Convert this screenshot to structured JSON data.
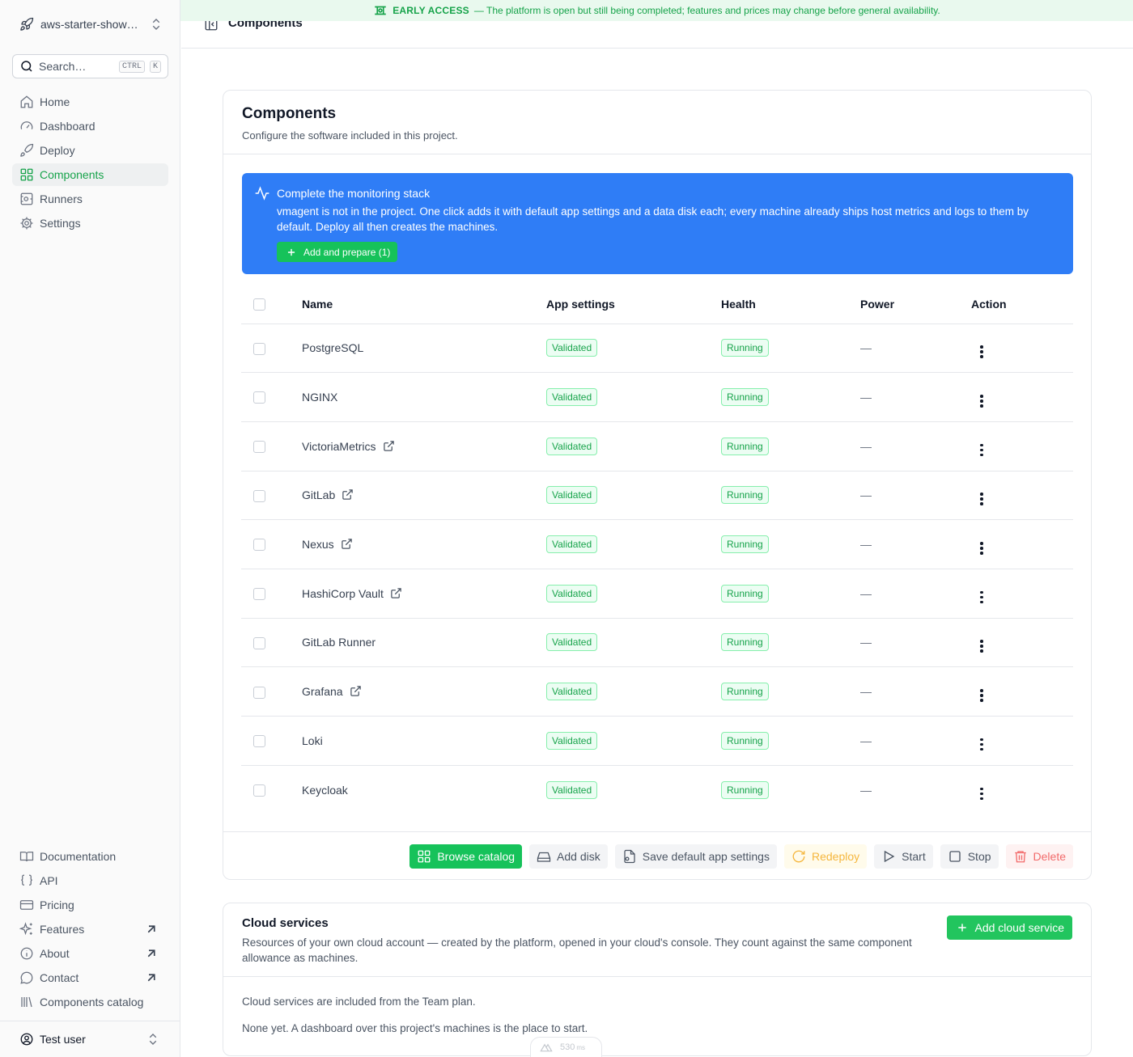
{
  "banner": {
    "tag": "EARLY ACCESS",
    "text": "— The platform is open but still being completed; features and prices may change before general availability."
  },
  "sidebar": {
    "project_name": "aws-starter-showc…",
    "search": {
      "placeholder": "Search…",
      "kbd_ctrl": "CTRL",
      "kbd_k": "K"
    },
    "nav": [
      {
        "label": "Home",
        "icon": "home-icon"
      },
      {
        "label": "Dashboard",
        "icon": "gauge-icon"
      },
      {
        "label": "Deploy",
        "icon": "rocket-icon"
      },
      {
        "label": "Components",
        "icon": "grid-icon",
        "active": true
      },
      {
        "label": "Runners",
        "icon": "runner-icon"
      },
      {
        "label": "Settings",
        "icon": "gear-icon"
      }
    ],
    "bottom_nav": [
      {
        "label": "Documentation",
        "icon": "book-icon"
      },
      {
        "label": "API",
        "icon": "braces-icon"
      },
      {
        "label": "Pricing",
        "icon": "card-icon"
      },
      {
        "label": "Features",
        "icon": "sparkles-icon",
        "external": true
      },
      {
        "label": "About",
        "icon": "info-icon",
        "external": true
      },
      {
        "label": "Contact",
        "icon": "chat-icon",
        "external": true
      },
      {
        "label": "Components catalog",
        "icon": "library-icon"
      }
    ],
    "user": "Test user"
  },
  "header": {
    "title": "Components"
  },
  "components_card": {
    "title": "Components",
    "subtitle": "Configure the software included in this project.",
    "alert": {
      "title": "Complete the monitoring stack",
      "description": "vmagent is not in the project. One click adds it with default app settings and a data disk each; every machine already ships host metrics and logs to them by default. Deploy all then creates the machines.",
      "button": "Add and prepare (1)"
    },
    "columns": [
      "Name",
      "App settings",
      "Health",
      "Power",
      "Action"
    ],
    "rows": [
      {
        "name": "PostgreSQL",
        "external": false,
        "app_settings": "Validated",
        "health": "Running",
        "power": "—"
      },
      {
        "name": "NGINX",
        "external": false,
        "app_settings": "Validated",
        "health": "Running",
        "power": "—"
      },
      {
        "name": "VictoriaMetrics",
        "external": true,
        "app_settings": "Validated",
        "health": "Running",
        "power": "—"
      },
      {
        "name": "GitLab",
        "external": true,
        "app_settings": "Validated",
        "health": "Running",
        "power": "—"
      },
      {
        "name": "Nexus",
        "external": true,
        "app_settings": "Validated",
        "health": "Running",
        "power": "—"
      },
      {
        "name": "HashiCorp Vault",
        "external": true,
        "app_settings": "Validated",
        "health": "Running",
        "power": "—"
      },
      {
        "name": "GitLab Runner",
        "external": false,
        "app_settings": "Validated",
        "health": "Running",
        "power": "—"
      },
      {
        "name": "Grafana",
        "external": true,
        "app_settings": "Validated",
        "health": "Running",
        "power": "—"
      },
      {
        "name": "Loki",
        "external": false,
        "app_settings": "Validated",
        "health": "Running",
        "power": "—"
      },
      {
        "name": "Keycloak",
        "external": false,
        "app_settings": "Validated",
        "health": "Running",
        "power": "—"
      }
    ],
    "footer_buttons": {
      "browse": "Browse catalog",
      "add_disk": "Add disk",
      "save_defaults": "Save default app settings",
      "redeploy": "Redeploy",
      "start": "Start",
      "stop": "Stop",
      "delete": "Delete"
    }
  },
  "cloud_card": {
    "title": "Cloud services",
    "description": "Resources of your own cloud account — created by the platform, opened in your cloud's console. They count against the same component allowance as machines.",
    "add_button": "Add cloud service",
    "plan_note": "Cloud services are included from the Team plan.",
    "empty_note": "None yet. A dashboard over this project's machines is the place to start."
  },
  "perf_indicator": {
    "value": "530",
    "unit": "ms"
  },
  "colors": {
    "accent": "#16a34a",
    "alert_bg": "#2f7df6",
    "banner_bg": "#e9f9ee"
  }
}
